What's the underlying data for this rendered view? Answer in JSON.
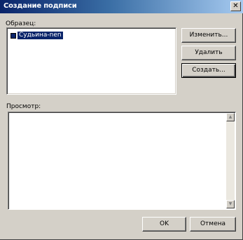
{
  "window": {
    "title": "Создание подписи"
  },
  "title_buttons": {
    "close": "✕"
  },
  "sample_section": {
    "label": "Образец:",
    "items": [
      {
        "label": "Судьина-nen"
      }
    ]
  },
  "buttons": {
    "change": "Изменить...",
    "delete": "Удалить",
    "create": "Создать...",
    "ok": "OK",
    "cancel": "Отмена"
  },
  "preview_section": {
    "label": "Просмотр:"
  },
  "scrollbar": {
    "up": "▲",
    "down": "▼"
  }
}
